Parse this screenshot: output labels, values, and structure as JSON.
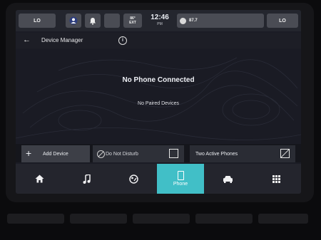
{
  "status_bar": {
    "left_button": "LO",
    "right_button": "LO",
    "temperature": "86°",
    "temperature_sub": "EXT",
    "clock": "12:46",
    "clock_sub": "PM",
    "radio_station": "87.7",
    "icons": [
      "driver-profile-icon",
      "bell-icon"
    ]
  },
  "title_bar": {
    "back": "←",
    "title": "Device Manager",
    "info": "i"
  },
  "content": {
    "message": "No Phone Connected",
    "sub_message": "No Paired Devices"
  },
  "actions": {
    "add_device": "Add Device",
    "do_not_disturb": "Do Not Disturb",
    "two_active_phones": "Two Active Phones"
  },
  "nav": {
    "phone_label": "Phone",
    "items": [
      "home-icon",
      "music-icon",
      "apps-companion-icon",
      "phone-icon",
      "vehicle-icon",
      "grid-icon"
    ]
  }
}
